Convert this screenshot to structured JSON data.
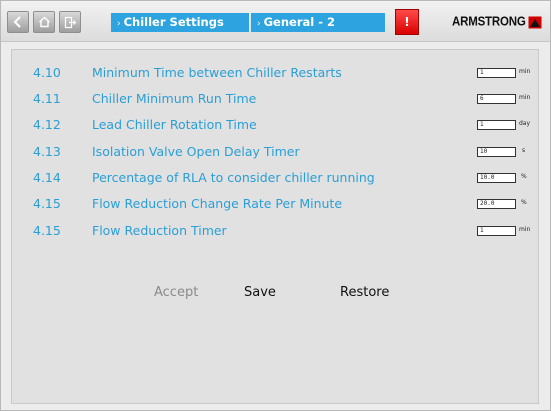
{
  "header": {
    "breadcrumb_1": "Chiller Settings",
    "breadcrumb_2": "General - 2",
    "alert_label": "!",
    "brand": "ARMSTRONG"
  },
  "settings": [
    {
      "num": "4.10",
      "label": "Minimum Time between Chiller Restarts",
      "value": "1",
      "unit": "min"
    },
    {
      "num": "4.11",
      "label": "Chiller Minimum Run Time",
      "value": "6",
      "unit": "min"
    },
    {
      "num": "4.12",
      "label": "Lead Chiller Rotation Time",
      "value": "1",
      "unit": "day"
    },
    {
      "num": "4.13",
      "label": "Isolation Valve Open Delay Timer",
      "value": "10",
      "unit": "s"
    },
    {
      "num": "4.14",
      "label": "Percentage of RLA to consider chiller running",
      "value": "10.0",
      "unit": "%"
    },
    {
      "num": "4.15",
      "label": "Flow Reduction Change Rate Per Minute",
      "value": "20.0",
      "unit": "%"
    },
    {
      "num": "4.15",
      "label": "Flow Reduction Timer",
      "value": "1",
      "unit": "min"
    }
  ],
  "actions": {
    "accept": "Accept",
    "save": "Save",
    "restore": "Restore"
  },
  "colors": {
    "accent": "#2da4e0",
    "label_text": "#2a9fd6",
    "alert": "#e00000",
    "disabled_text": "#8a8a8a"
  },
  "icons": [
    "back-icon",
    "home-icon",
    "exit-icon",
    "alert-icon",
    "armstrong-logo"
  ]
}
